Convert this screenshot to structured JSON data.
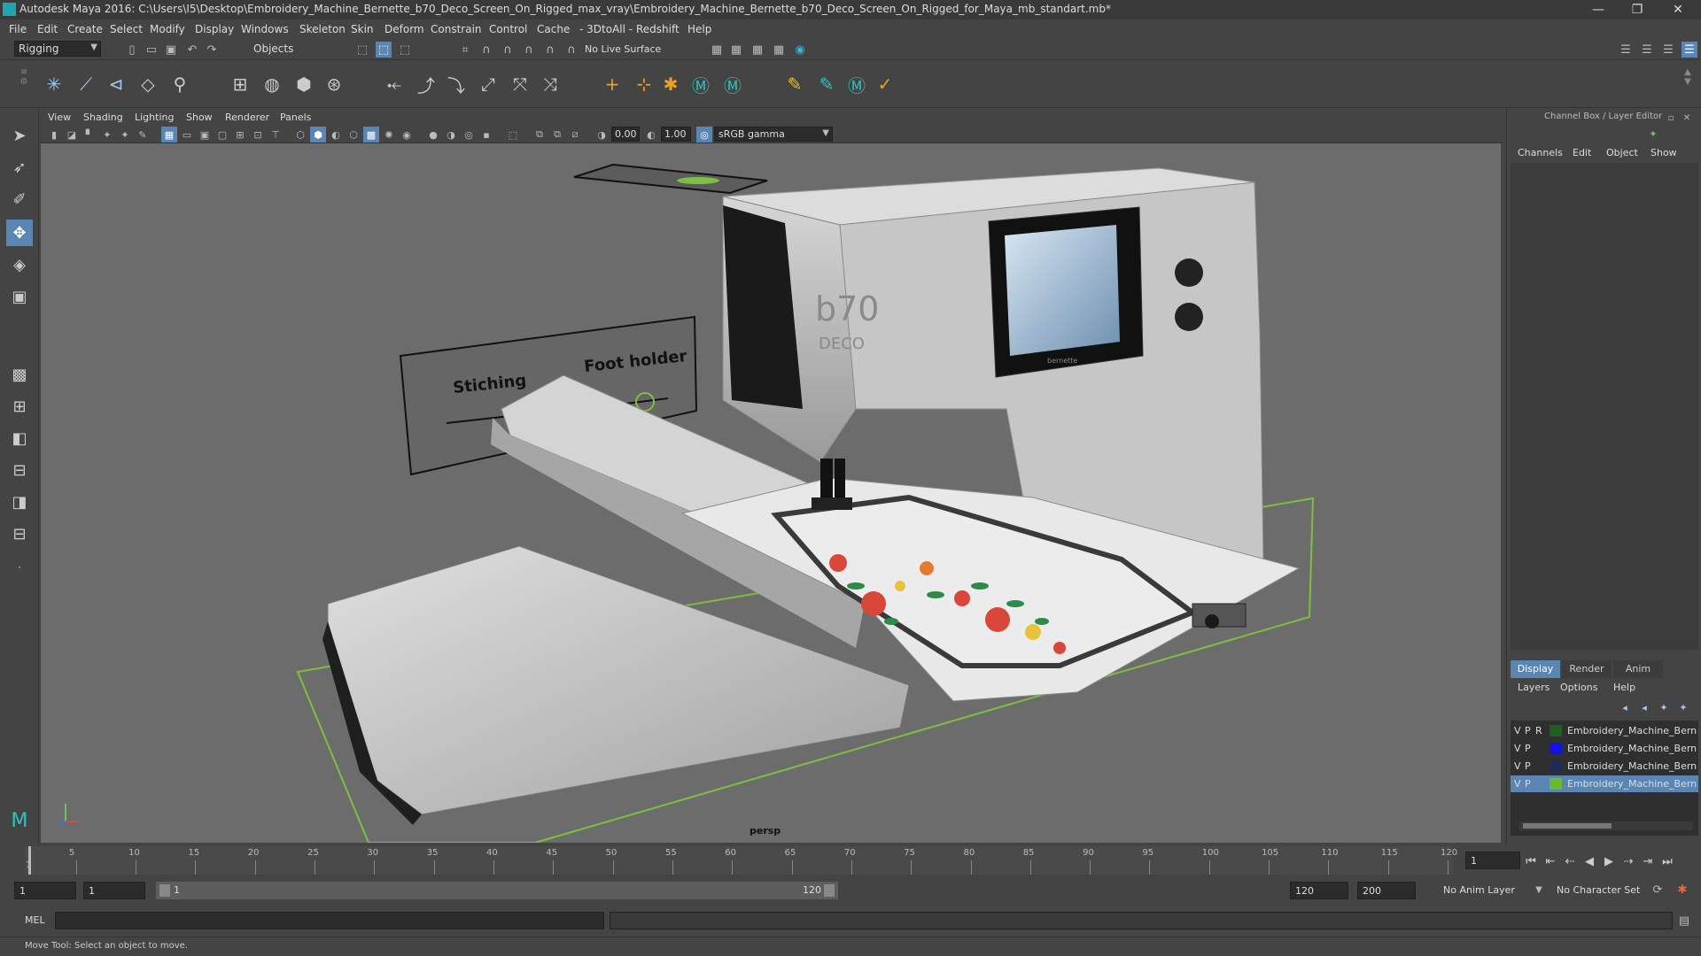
{
  "window": {
    "title": "Autodesk Maya 2016: C:\\Users\\I5\\Desktop\\Embroidery_Machine_Bernette_b70_Deco_Screen_On_Rigged_max_vray\\Embroidery_Machine_Bernette_b70_Deco_Screen_On_Rigged_for_Maya_mb_standart.mb*",
    "minimize": "—",
    "maximize": "❐",
    "close": "✕"
  },
  "menubar": [
    "File",
    "Edit",
    "Create",
    "Select",
    "Modify",
    "Display",
    "Windows",
    "Skeleton",
    "Skin",
    "Deform",
    "Constrain",
    "Control",
    "Cache",
    "- 3DtoAll -",
    "Redshift",
    "Help"
  ],
  "statusline": {
    "mode": "Rigging",
    "selection_mode": "Objects",
    "live_surface": "No Live Surface"
  },
  "viewport": {
    "menu": [
      "View",
      "Shading",
      "Lighting",
      "Show",
      "Renderer",
      "Panels"
    ],
    "exposure": "0.00",
    "gamma": "1.00",
    "color_space": "sRGB gamma",
    "camera": "persp",
    "labels": {
      "stitching": "Stiching",
      "foot_holder": "Foot holder",
      "brand_big": "b70",
      "brand_small": "DECO",
      "screen_brand": "bernette"
    }
  },
  "channel_box": {
    "title": "Channel Box / Layer Editor",
    "menu": [
      "Channels",
      "Edit",
      "Object",
      "Show"
    ],
    "tabs": [
      "Display",
      "Render",
      "Anim"
    ],
    "layer_menu": [
      "Layers",
      "Options",
      "Help"
    ],
    "layers": [
      {
        "v": "V",
        "p": "P",
        "r": "R",
        "color": "#1f5f1f",
        "name": "Embroidery_Machine_Bernette"
      },
      {
        "v": "V",
        "p": "P",
        "r": "",
        "color": "#1414e0",
        "name": "Embroidery_Machine_Bernette"
      },
      {
        "v": "V",
        "p": "P",
        "r": "",
        "color": "#222a55",
        "name": "Embroidery_Machine_Bernette"
      },
      {
        "v": "V",
        "p": "P",
        "r": "",
        "color": "#66bb33",
        "name": "Embroidery_Machine_Bernette"
      }
    ]
  },
  "timeline": {
    "ticks": [
      "5",
      "10",
      "15",
      "20",
      "25",
      "30",
      "35",
      "40",
      "45",
      "50",
      "55",
      "60",
      "65",
      "70",
      "75",
      "80",
      "85",
      "90",
      "95",
      "100",
      "105",
      "110",
      "115",
      "120"
    ],
    "start_tick": "1",
    "current_frame": "1"
  },
  "range": {
    "start": "1",
    "playback_start": "1",
    "slider_start": "1",
    "slider_end": "120",
    "playback_end": "120",
    "end": "200",
    "anim_layer": "No Anim Layer",
    "character_set": "No Character Set"
  },
  "command": {
    "label": "MEL"
  },
  "help_line": "Move Tool: Select an object to move."
}
